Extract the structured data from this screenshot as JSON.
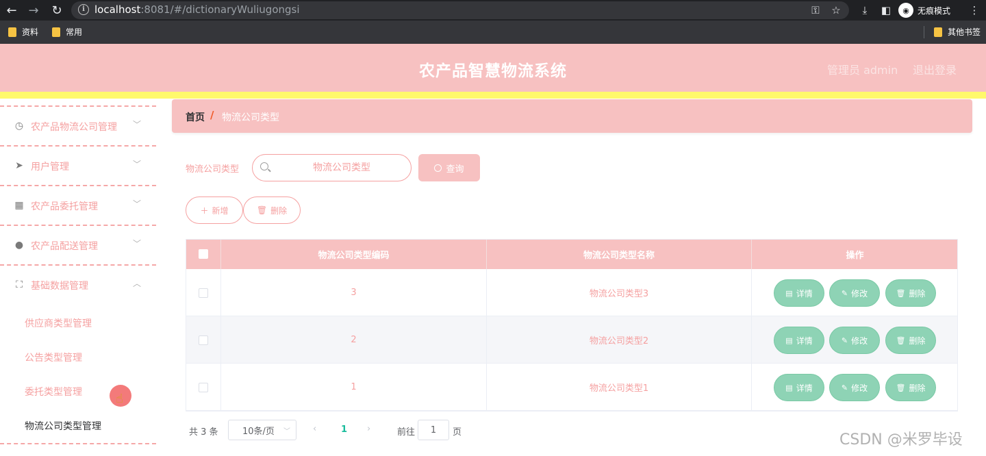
{
  "browser": {
    "url_host": "localhost",
    "url_path": ":8081/#/dictionaryWuliugongsi",
    "incognito_label": "无痕模式",
    "bookmarks": [
      "资料",
      "常用"
    ],
    "other_bookmarks": "其他书签"
  },
  "header": {
    "title": "农产品智慧物流系统",
    "user": "管理员 admin",
    "logout": "退出登录"
  },
  "sidebar": {
    "items": [
      {
        "label": "农产品物流公司管理",
        "icon": "clock-icon",
        "expanded": false
      },
      {
        "label": "用户管理",
        "icon": "paper-plane-icon",
        "expanded": false
      },
      {
        "label": "农产品委托管理",
        "icon": "chart-icon",
        "expanded": false
      },
      {
        "label": "农产品配送管理",
        "icon": "user-icon",
        "expanded": false
      },
      {
        "label": "基础数据管理",
        "icon": "scan-icon",
        "expanded": true
      }
    ],
    "sub_items": [
      "供应商类型管理",
      "公告类型管理",
      "委托类型管理",
      "物流公司类型管理"
    ]
  },
  "breadcrumb": {
    "home": "首页",
    "separator": "/",
    "current": "物流公司类型"
  },
  "search": {
    "label": "物流公司类型",
    "placeholder": "物流公司类型",
    "button": "查询"
  },
  "actions": {
    "add": "新增",
    "delete": "删除"
  },
  "table": {
    "columns": [
      "物流公司类型编码",
      "物流公司类型名称",
      "操作"
    ],
    "rows": [
      {
        "code": "3",
        "name": "物流公司类型3"
      },
      {
        "code": "2",
        "name": "物流公司类型2"
      },
      {
        "code": "1",
        "name": "物流公司类型1"
      }
    ],
    "row_actions": {
      "detail": "详情",
      "edit": "修改",
      "delete": "删除"
    }
  },
  "pagination": {
    "total": "共 3 条",
    "page_size": "10条/页",
    "current_page": "1",
    "goto_label": "前往",
    "goto_value": "1",
    "page_unit": "页"
  },
  "watermark": "CSDN @米罗毕设",
  "colors": {
    "header_bg": "#f7c1c1",
    "accent_yellow": "#fff96b",
    "action_green": "#8ed3b5",
    "text_pink": "#f5a0a0"
  }
}
